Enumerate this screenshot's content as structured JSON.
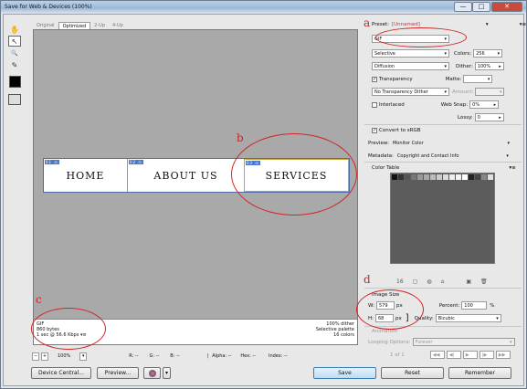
{
  "window": {
    "title": "Save for Web & Devices (100%)",
    "controls": {
      "minimize": "—",
      "maximize": "□",
      "close": "✕"
    }
  },
  "tools": [
    {
      "icon": "hand-icon",
      "glyph": "✋"
    },
    {
      "icon": "slice-select-icon",
      "glyph": "↖"
    },
    {
      "icon": "zoom-icon",
      "glyph": "🔍"
    },
    {
      "icon": "eyedropper-icon",
      "glyph": "✎"
    }
  ],
  "tabs": [
    "Original",
    "Optimized",
    "2-Up",
    "4-Up"
  ],
  "active_tab": "Optimized",
  "preview": {
    "nav_items": [
      "HOME",
      "ABOUT US",
      "SERVICES"
    ],
    "slice_tags": [
      "01 ⊡",
      "02 ⊡",
      "03 ⊡"
    ],
    "status_left": [
      "GIF",
      "860 bytes",
      "1 sec @ 56.6 Kbps"
    ],
    "status_left_menu": "▾≡",
    "status_right": [
      "100% dither",
      "Selective palette",
      "16 colors"
    ]
  },
  "annotations": {
    "a": "a",
    "b": "b",
    "c": "c",
    "d": "d",
    "color": "#d02424"
  },
  "settings": {
    "preset_label": "Preset:",
    "preset_value": "[Unnamed]",
    "panel_menu": "▾≡",
    "format": "GIF",
    "reduction": "Selective",
    "colors_label": "Colors:",
    "colors_value": "256",
    "dither_algo": "Diffusion",
    "dither_label": "Dither:",
    "dither_value": "100%",
    "transparency_label": "Transparency",
    "matte_label": "Matte:",
    "transparency_dither": "No Transparency Dither",
    "amount_label": "Amount:",
    "interlaced_label": "Interlaced",
    "websnap_label": "Web Snap:",
    "websnap_value": "0%",
    "lossy_label": "Lossy:",
    "lossy_value": "0",
    "convert_label": "Convert to sRGB",
    "preview_label": "Preview:",
    "preview_value": "Monitor Color",
    "metadata_label": "Metadata:",
    "metadata_value": "Copyright and Contact Info",
    "color_table_label": "Color Table",
    "color_table_count": "16",
    "swatches": [
      "#111111",
      "#333333",
      "#555555",
      "#777777",
      "#999999",
      "#aaaaaa",
      "#bbbbbb",
      "#cccccc",
      "#dddddd",
      "#eeeeee",
      "#f4f4f4",
      "#ffffff",
      "#222222",
      "#444444",
      "#888888",
      "#e0e0e0"
    ]
  },
  "image_size": {
    "label": "Image Size",
    "w_label": "W:",
    "w_value": "579",
    "w_unit": "px",
    "h_label": "H:",
    "h_value": "68",
    "h_unit": "px",
    "percent_label": "Percent:",
    "percent_value": "100",
    "percent_unit": "%",
    "quality_label": "Quality:",
    "quality_value": "Bicubic"
  },
  "animation": {
    "label": "Animation",
    "looping_label": "Looping Options:",
    "looping_value": "Forever",
    "frame_counter": "1 of 1",
    "controls": [
      "◀◀",
      "◀|",
      "▶",
      "|▶",
      "▶▶"
    ]
  },
  "zoom_bar": {
    "zoom_value": "100%",
    "r": "R: --",
    "g": "G: --",
    "b": "B: --",
    "alpha": "Alpha: --",
    "hex": "Hex: --",
    "index": "Index: --"
  },
  "buttons": {
    "device_central": "Device Central...",
    "preview": "Preview...",
    "save": "Save",
    "reset": "Reset",
    "remember": "Remember"
  }
}
